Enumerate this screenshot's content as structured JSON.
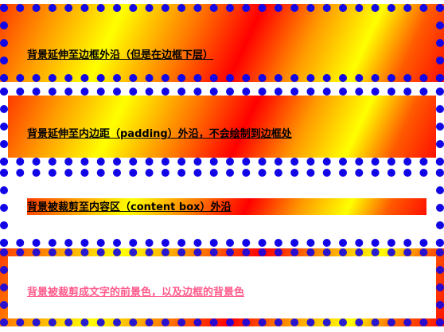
{
  "boxes": [
    {
      "label": "背景延伸至边框外沿（但是在边框下层）"
    },
    {
      "label": "背景延伸至内边距（padding）外沿，不会绘制到边框处"
    },
    {
      "label": "背景被裁剪至内容区（content box）外沿"
    },
    {
      "label": "背景被裁剪成文字的前景色，以及边框的背景色"
    }
  ],
  "colors": {
    "border": "#1206e6",
    "gradient": [
      "#ff0000",
      "#ff9a00",
      "#ffff00"
    ],
    "text_clip": "#ff5a8a"
  }
}
